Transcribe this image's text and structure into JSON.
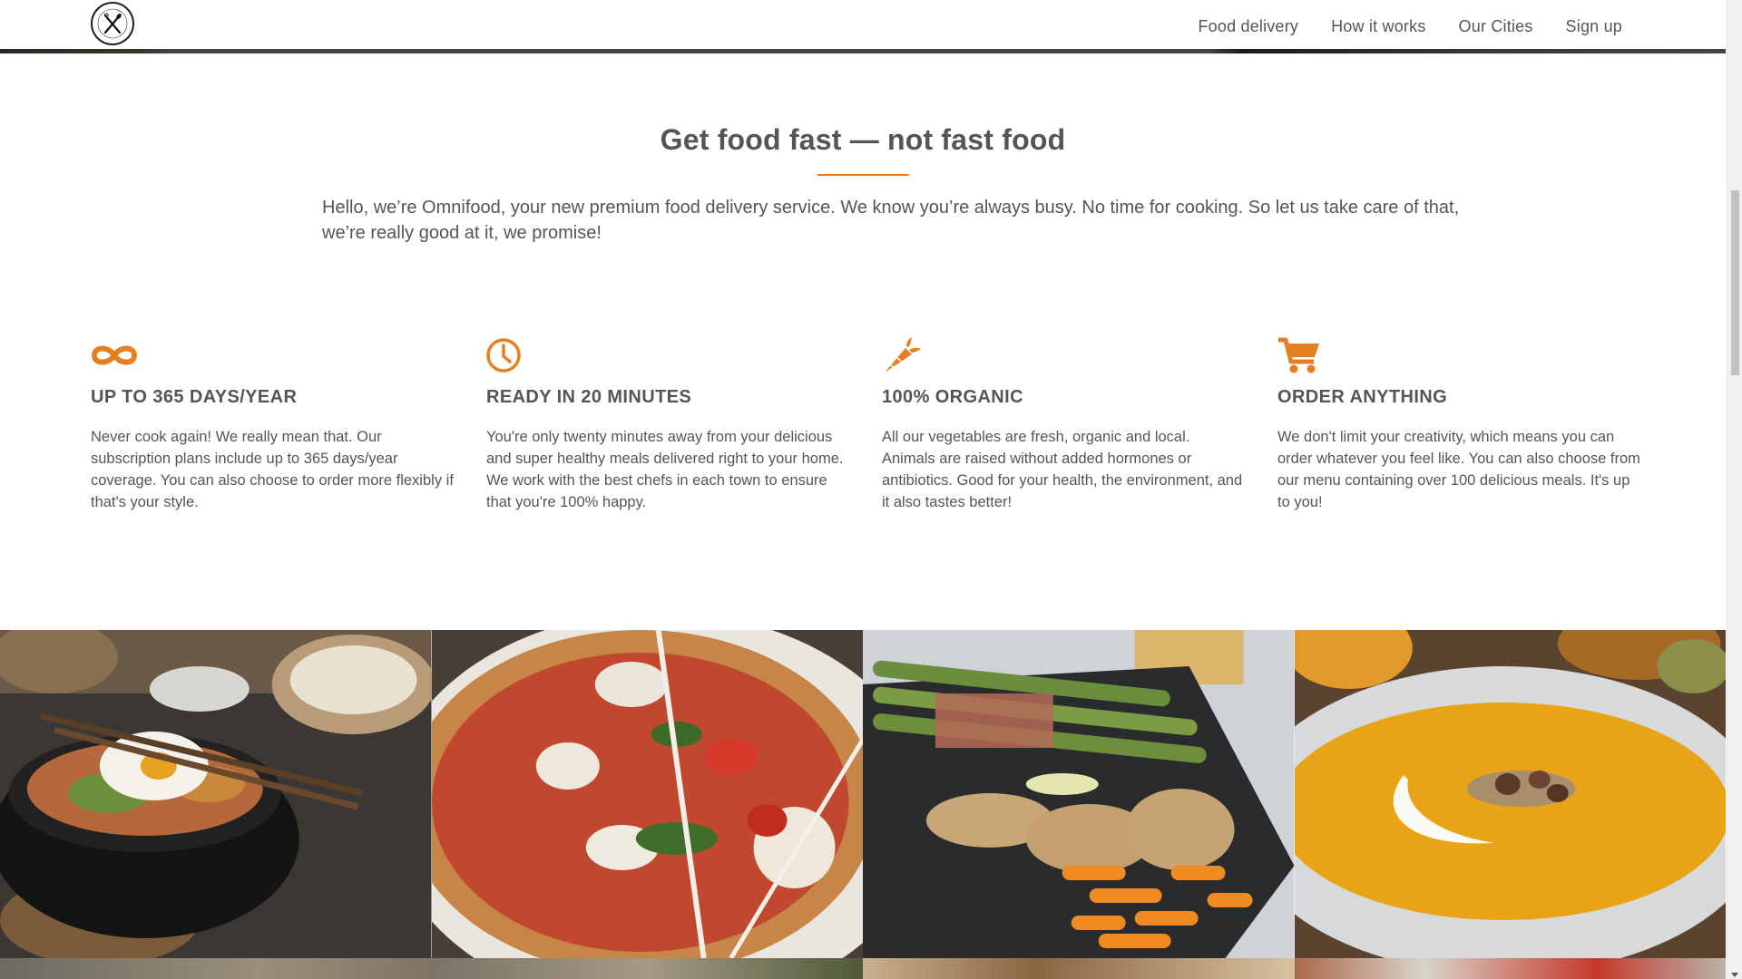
{
  "nav": {
    "logo_alt": "Omnifood logo",
    "links": [
      "Food delivery",
      "How it works",
      "Our Cities",
      "Sign up"
    ]
  },
  "intro": {
    "title": "Get food fast — not fast food",
    "text": "Hello, we’re Omnifood, your new premium food delivery service. We know you’re always busy. No time for cooking. So let us take care of that, we’re really good at it, we promise!"
  },
  "features": [
    {
      "icon": "infinity-icon",
      "title": "Up to 365 days/year",
      "text": "Never cook again! We really mean that. Our subscription plans include up to 365 days/year coverage. You can also choose to order more flexibly if that's your style."
    },
    {
      "icon": "clock-icon",
      "title": "Ready in 20 minutes",
      "text": "You're only twenty minutes away from your delicious and super healthy meals delivered right to your home. We work with the best chefs in each town to ensure that you're 100% happy."
    },
    {
      "icon": "carrot-icon",
      "title": "100% organic",
      "text": "All our vegetables are fresh, organic and local. Animals are raised without added hormones or antibiotics. Good for your health, the environment, and it also tastes better!"
    },
    {
      "icon": "cart-icon",
      "title": "Order anything",
      "text": "We don't limit your creativity, which means you can order whatever you feel like. You can also choose from our menu containing over 100 delicious meals. It's up to you!"
    }
  ],
  "gallery": [
    {
      "icon": "bibimbap-photo"
    },
    {
      "icon": "pizza-photo"
    },
    {
      "icon": "chicken-asparagus-photo"
    },
    {
      "icon": "pumpkin-soup-photo"
    }
  ],
  "colors": {
    "accent": "#e67e22",
    "text": "#555555",
    "background": "#ffffff"
  }
}
